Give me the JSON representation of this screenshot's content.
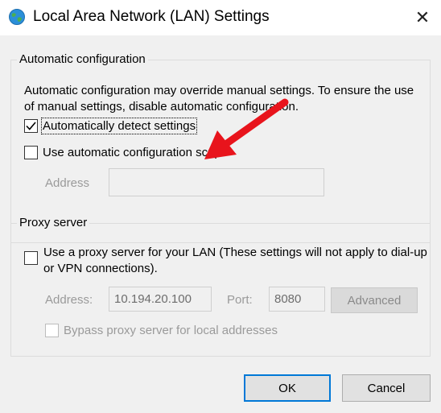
{
  "window": {
    "title": "Local Area Network (LAN) Settings",
    "close_glyph": "✕",
    "icon": "network-globe-icon"
  },
  "auto_config": {
    "legend": "Automatic configuration",
    "description": "Automatic configuration may override manual settings.  To ensure the use of manual settings, disable automatic configuration.",
    "detect_label": "Automatically detect settings",
    "detect_checked": true,
    "script_label": "Use automatic configuration script",
    "script_checked": false,
    "address_label": "Address",
    "address_value": ""
  },
  "proxy": {
    "legend": "Proxy server",
    "use_proxy_label": "Use a proxy server for your LAN (These settings will not apply to dial-up or VPN connections).",
    "use_proxy_checked": false,
    "address_label": "Address:",
    "address_value": "10.194.20.100",
    "port_label": "Port:",
    "port_value": "8080",
    "advanced_label": "Advanced",
    "bypass_label": "Bypass proxy server for local addresses",
    "bypass_checked": false
  },
  "buttons": {
    "ok_label": "OK",
    "cancel_label": "Cancel"
  },
  "annotation": {
    "arrow_color": "#e8141c",
    "icon": "red-arrow-icon"
  }
}
